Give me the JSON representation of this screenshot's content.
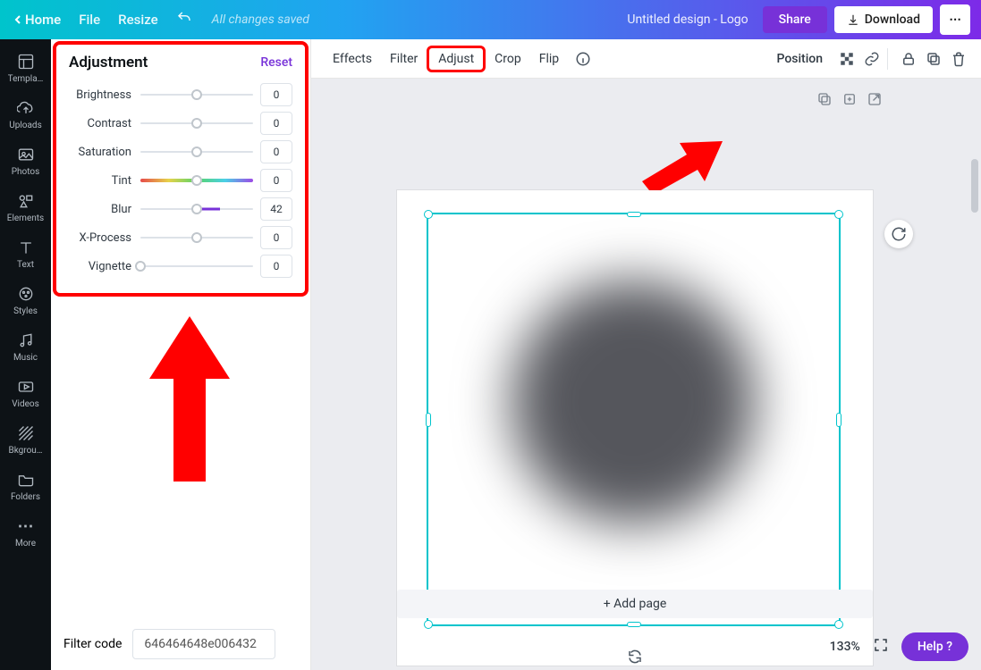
{
  "topbar": {
    "home": "Home",
    "file": "File",
    "resize": "Resize",
    "status": "All changes saved",
    "docname": "Untitled design - Logo",
    "share": "Share",
    "download": "Download"
  },
  "left_nav": {
    "templates": "Templa…",
    "uploads": "Uploads",
    "photos": "Photos",
    "elements": "Elements",
    "text": "Text",
    "styles": "Styles",
    "music": "Music",
    "videos": "Videos",
    "background": "Bkgrou…",
    "folders": "Folders",
    "more": "More"
  },
  "panel": {
    "title": "Adjustment",
    "reset": "Reset",
    "sliders": {
      "brightness": {
        "label": "Brightness",
        "value": "0",
        "knob_pct": 50
      },
      "contrast": {
        "label": "Contrast",
        "value": "0",
        "knob_pct": 50
      },
      "saturation": {
        "label": "Saturation",
        "value": "0",
        "knob_pct": 50
      },
      "tint": {
        "label": "Tint",
        "value": "0",
        "knob_pct": 50,
        "gradient": true
      },
      "blur": {
        "label": "Blur",
        "value": "42",
        "knob_pct": 50,
        "fill_from": 50,
        "fill_to": 70
      },
      "xprocess": {
        "label": "X-Process",
        "value": "0",
        "knob_pct": 50
      },
      "vignette": {
        "label": "Vignette",
        "value": "0",
        "knob_pct": 0
      }
    },
    "filtercode_label": "Filter code",
    "filtercode_value": "646464648e006432"
  },
  "toolbar": {
    "effects": "Effects",
    "filter": "Filter",
    "adjust": "Adjust",
    "crop": "Crop",
    "flip": "Flip",
    "position": "Position"
  },
  "canvas": {
    "addpage": "+ Add page",
    "zoom": "133%",
    "help": "Help ?"
  }
}
